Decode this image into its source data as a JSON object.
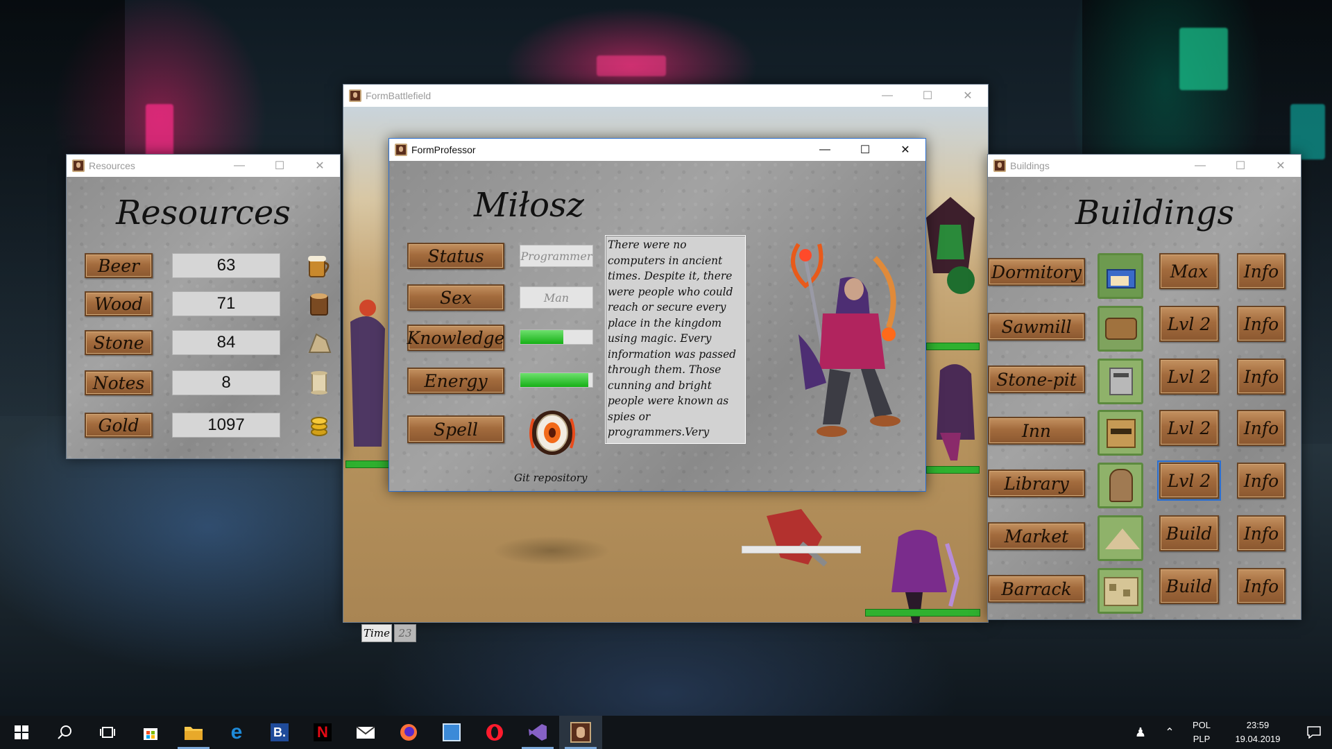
{
  "windows": {
    "battlefield": {
      "title": "FormBattlefield",
      "time_label": "Time",
      "time_value": "23"
    },
    "resources": {
      "title": "Resources",
      "heading": "Resources",
      "items": [
        {
          "label": "Beer",
          "value": "63",
          "icon": "beer-mug-icon"
        },
        {
          "label": "Wood",
          "value": "71",
          "icon": "wood-log-icon"
        },
        {
          "label": "Stone",
          "value": "84",
          "icon": "stone-icon"
        },
        {
          "label": "Notes",
          "value": "8",
          "icon": "scroll-icon"
        },
        {
          "label": "Gold",
          "value": "1097",
          "icon": "gold-coins-icon"
        }
      ]
    },
    "buildings": {
      "title": "Buildings",
      "heading": "Buildings",
      "rows": [
        {
          "name": "Dormitory",
          "action": "Max",
          "info": "Info"
        },
        {
          "name": "Sawmill",
          "action": "Lvl 2",
          "info": "Info"
        },
        {
          "name": "Stone-pit",
          "action": "Lvl 2",
          "info": "Info"
        },
        {
          "name": "Inn",
          "action": "Lvl 2",
          "info": "Info"
        },
        {
          "name": "Library",
          "action": "Lvl 2",
          "info": "Info"
        },
        {
          "name": "Market",
          "action": "Build",
          "info": "Info"
        },
        {
          "name": "Barrack",
          "action": "Build",
          "info": "Info"
        }
      ]
    },
    "professor": {
      "title": "FormProfessor",
      "name": "Miłosz",
      "status_label": "Status",
      "status_value": "Programmer",
      "sex_label": "Sex",
      "sex_value": "Man",
      "knowledge_label": "Knowledge",
      "knowledge_progress": 0.6,
      "energy_label": "Energy",
      "energy_progress": 0.94,
      "spell_label": "Spell",
      "spell_caption": "Git repository",
      "description": "There were no computers in ancient times. Despite it, there were people who could reach or secure every place in the kingdom using magic. Every information was passed through them. Those cunning and bright people were known as spies or programmers.Very useful when you want to avoid fights or feel safety."
    }
  },
  "taskbar": {
    "items": [
      "windows-start-icon",
      "search-icon",
      "task-view-icon",
      "store-icon",
      "file-explorer-icon",
      "edge-icon",
      "booking-icon",
      "netflix-icon",
      "mail-icon",
      "firefox-icon",
      "paint-icon",
      "opera-icon",
      "visual-studio-icon",
      "game-app-icon"
    ],
    "lang_top": "POL",
    "lang_bottom": "PLP",
    "time": "23:59",
    "date": "19.04.2019"
  },
  "colors": {
    "wood": "#a36b3d",
    "hp_green": "#2fb12f",
    "accent_blue": "#2b6fd1"
  }
}
